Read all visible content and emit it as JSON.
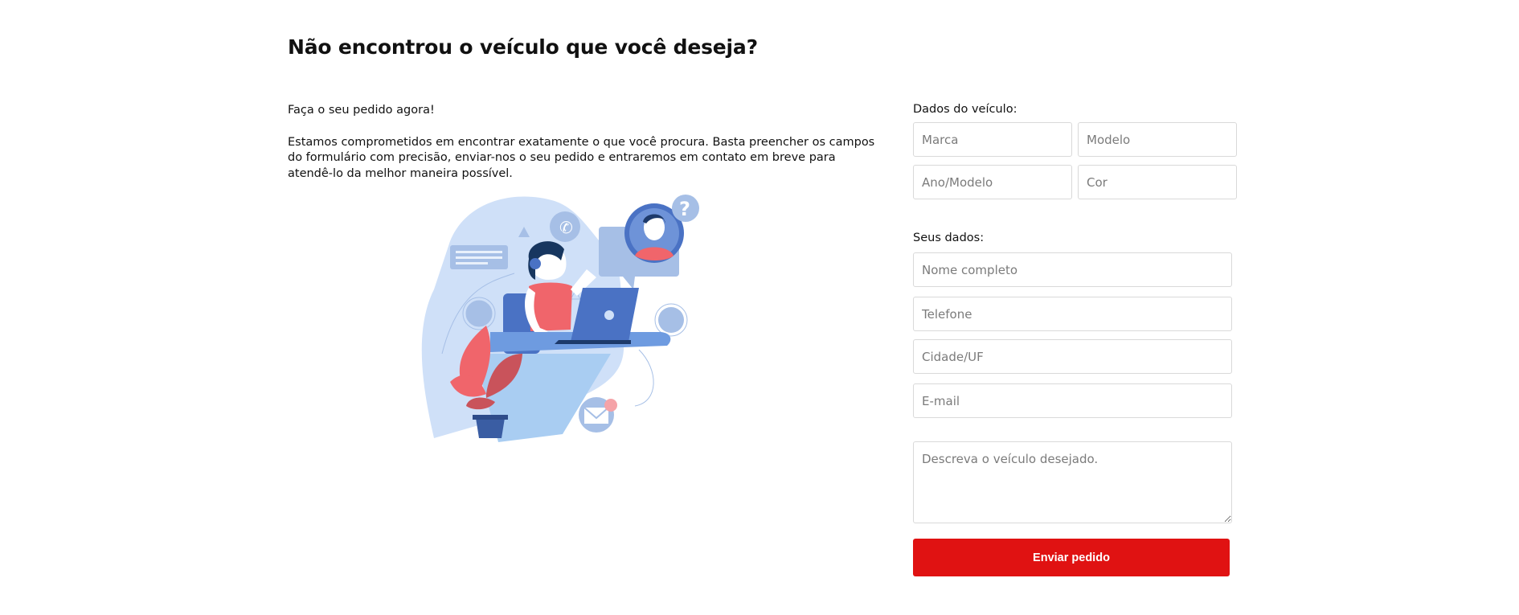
{
  "page": {
    "title": "Não encontrou o veículo que você deseja?",
    "intro_heading": "Faça o seu pedido agora!",
    "intro_body": "Estamos comprometidos em encontrar exatamente o que você procura. Basta preencher os campos do formulário com precisão, enviar-nos o seu pedido e entraremos em contato em breve para atendê-lo da melhor maneira possível."
  },
  "vehicle": {
    "label": "Dados do veículo:",
    "marca_placeholder": "Marca",
    "modelo_placeholder": "Modelo",
    "ano_placeholder": "Ano/Modelo",
    "cor_placeholder": "Cor"
  },
  "personal": {
    "label": "Seus dados:",
    "nome_placeholder": "Nome completo",
    "telefone_placeholder": "Telefone",
    "cidade_placeholder": "Cidade/UF",
    "email_placeholder": "E-mail",
    "descricao_placeholder": "Descreva o veículo desejado."
  },
  "actions": {
    "submit_label": "Enviar pedido"
  },
  "colors": {
    "accent": "#e01212",
    "illustration_light": "#cfe0f8",
    "illustration_blue": "#4a72c4",
    "illustration_coral": "#f0656b"
  }
}
